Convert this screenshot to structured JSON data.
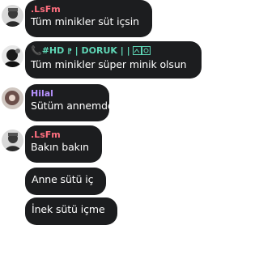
{
  "colors": {
    "bubble": "#1c1d1f",
    "text": "#ffffff",
    "sender_lsfm": "#ff6f7f",
    "sender_doruk": "#5fd6b6",
    "sender_hilal": "#b691ff"
  },
  "messages": [
    {
      "sender": ".LsFm",
      "text": "Tüm minikler süt içsin",
      "avatar": "lsfm-avatar"
    },
    {
      "sender_prefix": "📞#HD",
      "sender_main": "| DORUK | |",
      "text": "Tüm minikler süper minik olsun",
      "avatar": "doruk-avatar"
    },
    {
      "sender": "Hilal",
      "text": "Sütüm annemden",
      "avatar": "hilal-avatar"
    },
    {
      "sender": ".LsFm",
      "text": "Bakın bakın",
      "avatar": "lsfm-avatar"
    },
    {
      "text": "Anne sütü iç"
    },
    {
      "text": "İnek sütü içme"
    }
  ]
}
